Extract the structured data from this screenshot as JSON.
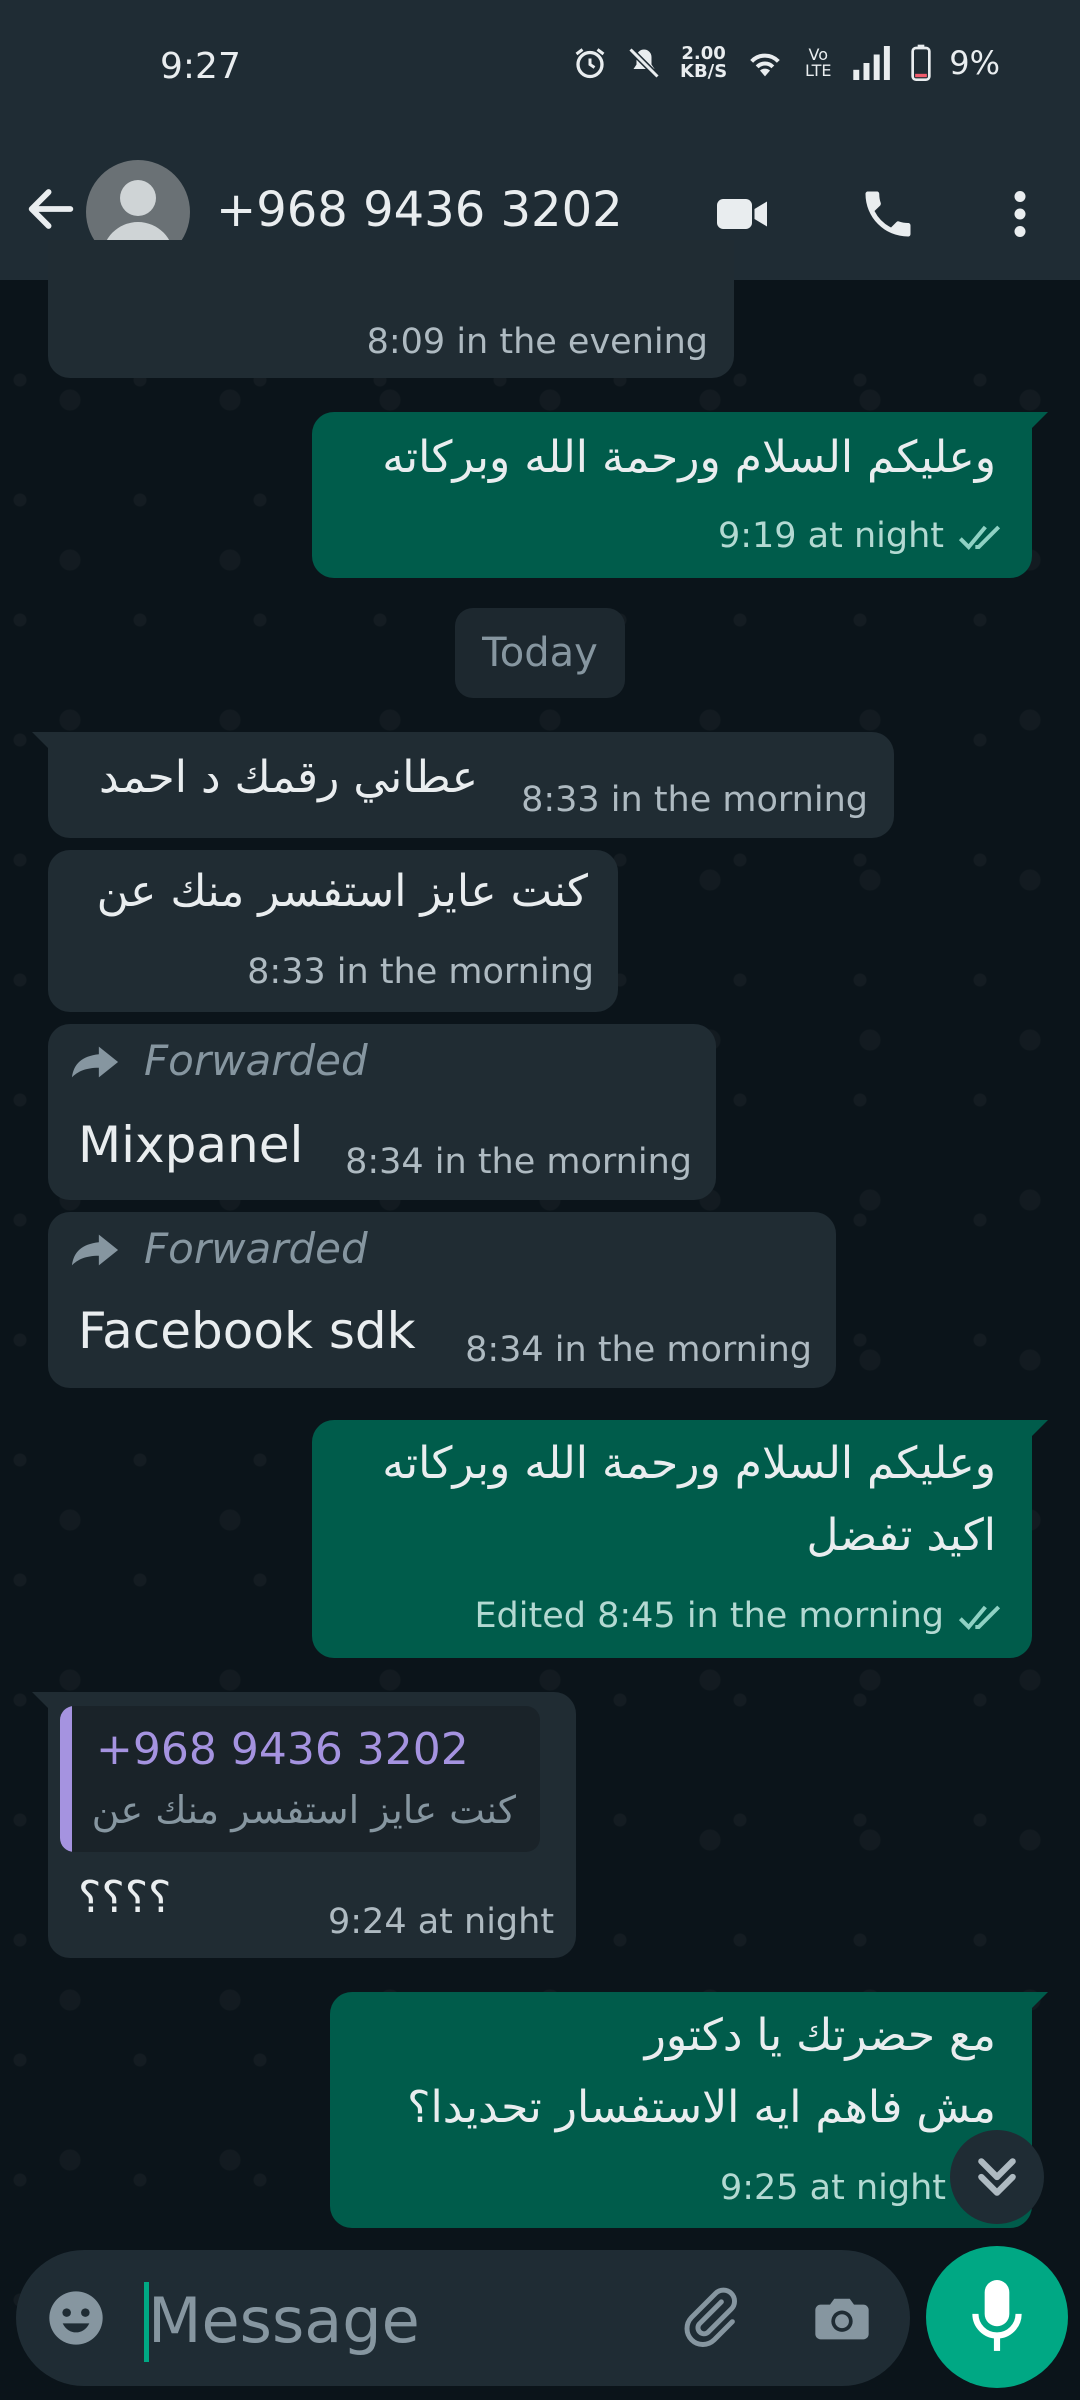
{
  "status": {
    "time": "9:27",
    "net_speed_value": "2.00",
    "net_speed_unit": "KB/S",
    "volte": "Vo LTE",
    "battery": "9%"
  },
  "header": {
    "contact": "+968 9436 3202",
    "icons": [
      "back-arrow-icon",
      "avatar",
      "video-call-icon",
      "voice-call-icon",
      "more-options-icon"
    ]
  },
  "messages": [
    {
      "dir": "in",
      "time": "8:09 in the evening"
    },
    {
      "dir": "out",
      "text": "وعليكم السلام ورحمة الله وبركاته",
      "time": "9:19 at night",
      "read": true
    },
    {
      "dir": "in",
      "text": "عطاني رقمك د احمد",
      "time": "8:33 in the morning"
    },
    {
      "dir": "in",
      "text": "كنت عايز استفسر منك عن",
      "time": "8:33 in the morning"
    },
    {
      "dir": "in",
      "forwarded": "Forwarded",
      "text": "Mixpanel",
      "time": "8:34 in the morning"
    },
    {
      "dir": "in",
      "forwarded": "Forwarded",
      "text": "Facebook sdk",
      "time": "8:34 in the morning"
    },
    {
      "dir": "out",
      "line1": "وعليكم السلام ورحمة الله وبركاته",
      "line2": "اكيد تفضل",
      "time": "Edited 8:45 in the morning",
      "read": true
    },
    {
      "dir": "in",
      "quote_name": "+968 9436 3202",
      "quote_text": "كنت عايز استفسر منك عن",
      "text": "؟؟؟؟",
      "time": "9:24 at night"
    },
    {
      "dir": "out",
      "line1": "مع حضرتك يا دكتور",
      "line2": "مش فاهم ايه الاستفسار تحديدا؟",
      "time": "9:25 at night"
    }
  ],
  "date_divider": "Today",
  "composer": {
    "placeholder": "Message",
    "icons": [
      "emoji-icon",
      "attach-icon",
      "camera-icon",
      "mic-icon"
    ]
  },
  "colors": {
    "background": "#0b141a",
    "header": "#1f2c34",
    "incoming_bubble": "#202c33",
    "outgoing_bubble": "#005c4b",
    "accent": "#00a884",
    "quote_accent": "#a593e0"
  }
}
